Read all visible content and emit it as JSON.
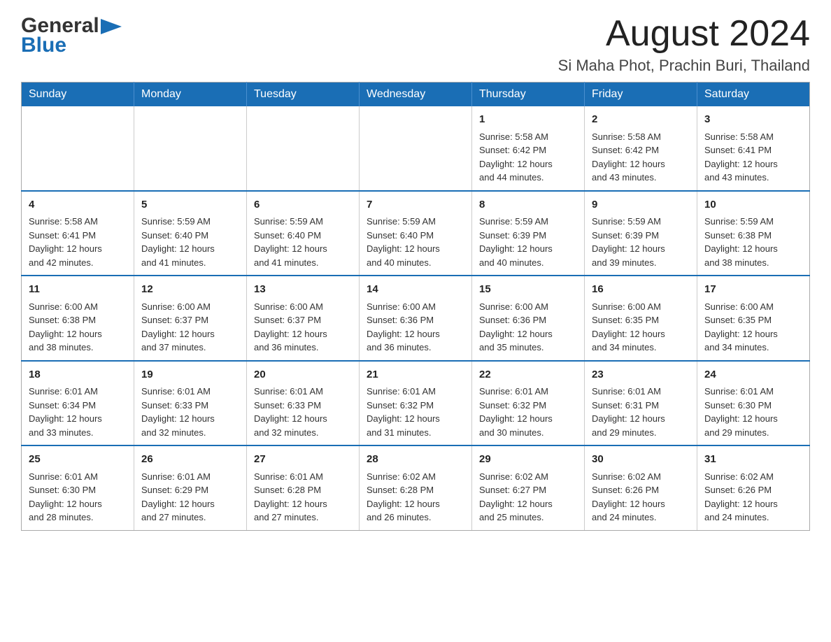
{
  "header": {
    "logo_general": "General",
    "logo_blue": "Blue",
    "month_title": "August 2024",
    "location": "Si Maha Phot, Prachin Buri, Thailand"
  },
  "weekdays": [
    "Sunday",
    "Monday",
    "Tuesday",
    "Wednesday",
    "Thursday",
    "Friday",
    "Saturday"
  ],
  "weeks": [
    [
      {
        "day": "",
        "info": ""
      },
      {
        "day": "",
        "info": ""
      },
      {
        "day": "",
        "info": ""
      },
      {
        "day": "",
        "info": ""
      },
      {
        "day": "1",
        "info": "Sunrise: 5:58 AM\nSunset: 6:42 PM\nDaylight: 12 hours\nand 44 minutes."
      },
      {
        "day": "2",
        "info": "Sunrise: 5:58 AM\nSunset: 6:42 PM\nDaylight: 12 hours\nand 43 minutes."
      },
      {
        "day": "3",
        "info": "Sunrise: 5:58 AM\nSunset: 6:41 PM\nDaylight: 12 hours\nand 43 minutes."
      }
    ],
    [
      {
        "day": "4",
        "info": "Sunrise: 5:58 AM\nSunset: 6:41 PM\nDaylight: 12 hours\nand 42 minutes."
      },
      {
        "day": "5",
        "info": "Sunrise: 5:59 AM\nSunset: 6:40 PM\nDaylight: 12 hours\nand 41 minutes."
      },
      {
        "day": "6",
        "info": "Sunrise: 5:59 AM\nSunset: 6:40 PM\nDaylight: 12 hours\nand 41 minutes."
      },
      {
        "day": "7",
        "info": "Sunrise: 5:59 AM\nSunset: 6:40 PM\nDaylight: 12 hours\nand 40 minutes."
      },
      {
        "day": "8",
        "info": "Sunrise: 5:59 AM\nSunset: 6:39 PM\nDaylight: 12 hours\nand 40 minutes."
      },
      {
        "day": "9",
        "info": "Sunrise: 5:59 AM\nSunset: 6:39 PM\nDaylight: 12 hours\nand 39 minutes."
      },
      {
        "day": "10",
        "info": "Sunrise: 5:59 AM\nSunset: 6:38 PM\nDaylight: 12 hours\nand 38 minutes."
      }
    ],
    [
      {
        "day": "11",
        "info": "Sunrise: 6:00 AM\nSunset: 6:38 PM\nDaylight: 12 hours\nand 38 minutes."
      },
      {
        "day": "12",
        "info": "Sunrise: 6:00 AM\nSunset: 6:37 PM\nDaylight: 12 hours\nand 37 minutes."
      },
      {
        "day": "13",
        "info": "Sunrise: 6:00 AM\nSunset: 6:37 PM\nDaylight: 12 hours\nand 36 minutes."
      },
      {
        "day": "14",
        "info": "Sunrise: 6:00 AM\nSunset: 6:36 PM\nDaylight: 12 hours\nand 36 minutes."
      },
      {
        "day": "15",
        "info": "Sunrise: 6:00 AM\nSunset: 6:36 PM\nDaylight: 12 hours\nand 35 minutes."
      },
      {
        "day": "16",
        "info": "Sunrise: 6:00 AM\nSunset: 6:35 PM\nDaylight: 12 hours\nand 34 minutes."
      },
      {
        "day": "17",
        "info": "Sunrise: 6:00 AM\nSunset: 6:35 PM\nDaylight: 12 hours\nand 34 minutes."
      }
    ],
    [
      {
        "day": "18",
        "info": "Sunrise: 6:01 AM\nSunset: 6:34 PM\nDaylight: 12 hours\nand 33 minutes."
      },
      {
        "day": "19",
        "info": "Sunrise: 6:01 AM\nSunset: 6:33 PM\nDaylight: 12 hours\nand 32 minutes."
      },
      {
        "day": "20",
        "info": "Sunrise: 6:01 AM\nSunset: 6:33 PM\nDaylight: 12 hours\nand 32 minutes."
      },
      {
        "day": "21",
        "info": "Sunrise: 6:01 AM\nSunset: 6:32 PM\nDaylight: 12 hours\nand 31 minutes."
      },
      {
        "day": "22",
        "info": "Sunrise: 6:01 AM\nSunset: 6:32 PM\nDaylight: 12 hours\nand 30 minutes."
      },
      {
        "day": "23",
        "info": "Sunrise: 6:01 AM\nSunset: 6:31 PM\nDaylight: 12 hours\nand 29 minutes."
      },
      {
        "day": "24",
        "info": "Sunrise: 6:01 AM\nSunset: 6:30 PM\nDaylight: 12 hours\nand 29 minutes."
      }
    ],
    [
      {
        "day": "25",
        "info": "Sunrise: 6:01 AM\nSunset: 6:30 PM\nDaylight: 12 hours\nand 28 minutes."
      },
      {
        "day": "26",
        "info": "Sunrise: 6:01 AM\nSunset: 6:29 PM\nDaylight: 12 hours\nand 27 minutes."
      },
      {
        "day": "27",
        "info": "Sunrise: 6:01 AM\nSunset: 6:28 PM\nDaylight: 12 hours\nand 27 minutes."
      },
      {
        "day": "28",
        "info": "Sunrise: 6:02 AM\nSunset: 6:28 PM\nDaylight: 12 hours\nand 26 minutes."
      },
      {
        "day": "29",
        "info": "Sunrise: 6:02 AM\nSunset: 6:27 PM\nDaylight: 12 hours\nand 25 minutes."
      },
      {
        "day": "30",
        "info": "Sunrise: 6:02 AM\nSunset: 6:26 PM\nDaylight: 12 hours\nand 24 minutes."
      },
      {
        "day": "31",
        "info": "Sunrise: 6:02 AM\nSunset: 6:26 PM\nDaylight: 12 hours\nand 24 minutes."
      }
    ]
  ],
  "colors": {
    "header_bg": "#1a6eb5",
    "header_text": "#ffffff",
    "border_accent": "#1a6eb5"
  }
}
